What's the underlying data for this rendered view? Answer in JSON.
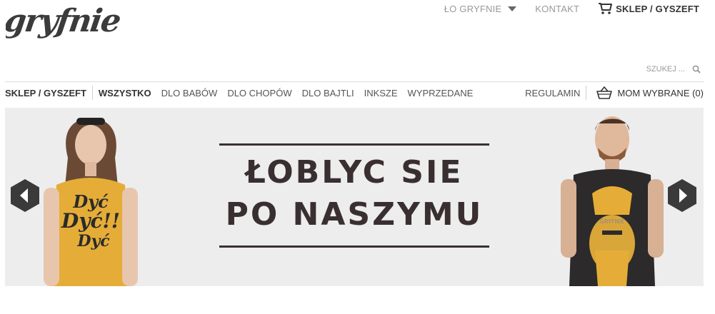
{
  "brand": {
    "logo_text": "gryfnie"
  },
  "top_nav": {
    "about_label": "ŁO GRYFNIE",
    "contact_label": "KONTAKT",
    "shop_label": "SKLEP / GYSZEFT"
  },
  "search": {
    "placeholder": "SZUKEJ ..."
  },
  "main_nav": {
    "section_label": "SKLEP / GYSZEFT",
    "categories": [
      "WSZYSTKO",
      "DLO BABÓW",
      "DLO CHOPÓW",
      "DLO BAJTLI",
      "INKSZE",
      "WYPRZEDANE"
    ],
    "terms_label": "REGULAMIN",
    "basket_label": "MOM WYBRANE (0)"
  },
  "banner": {
    "headline_line1": "ŁOBLYC SIE",
    "headline_line2": "PO NASZYMU",
    "left_shirt_text": [
      "Dyć",
      "Dyć!!",
      "Dyć"
    ],
    "right_shirt_text": "GRYFNIE"
  },
  "colors": {
    "accent_dark": "#3a3a3a",
    "headline": "#3a2f30",
    "banner_bg": "#ededee",
    "mustard": "#e5ad37"
  },
  "icons": [
    "dropdown-caret-icon",
    "cart-icon",
    "search-icon",
    "basket-icon",
    "chevron-left-icon",
    "chevron-right-icon"
  ]
}
